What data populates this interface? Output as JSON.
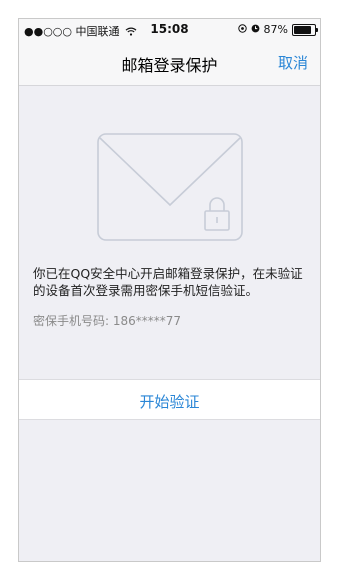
{
  "status_bar": {
    "carrier": "●●○○○ 中国联通",
    "wifi_icon": "wifi-icon",
    "time": "15:08",
    "battery_percent_text": "87%",
    "battery_level": 0.87
  },
  "nav": {
    "title": "邮箱登录保护",
    "cancel_label": "取消"
  },
  "content": {
    "notice_text": "你已在QQ安全中心开启邮箱登录保护，在未验证的设备首次登录需用密保手机短信验证。",
    "phone_label": "密保手机号码:",
    "phone_value": "186*****77"
  },
  "action": {
    "start_label": "开始验证"
  },
  "colors": {
    "accent": "#2a86d6",
    "background": "#efeff4",
    "envelope_stroke": "#c7ccd7"
  }
}
